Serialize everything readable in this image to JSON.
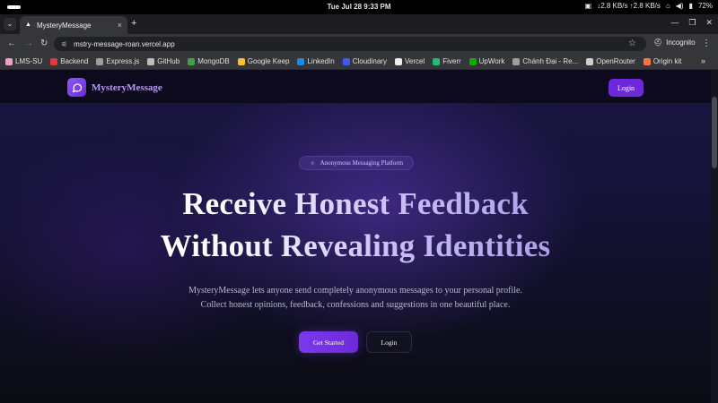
{
  "os": {
    "datetime": "Tue Jul 28   9:33 PM",
    "network_speed": "↓2.8 KB/s ↑2.8 KB/s",
    "battery": "72%"
  },
  "browser": {
    "tab_title": "MysteryMessage",
    "url": "mstry-message-roan.vercel.app",
    "incognito_label": "Incognito",
    "bookmarks": [
      {
        "label": "LMS-SU",
        "color": "#e9a3c9"
      },
      {
        "label": "Backend",
        "color": "#e53935"
      },
      {
        "label": "Express.js",
        "color": "#9e9e9e"
      },
      {
        "label": "GitHub",
        "color": "#bdbdbd"
      },
      {
        "label": "MongoDB",
        "color": "#43a047"
      },
      {
        "label": "Google Keep",
        "color": "#fbc02d"
      },
      {
        "label": "LinkedIn",
        "color": "#1e88e5"
      },
      {
        "label": "Cloudinary",
        "color": "#3d5afe"
      },
      {
        "label": "Vercel",
        "color": "#eeeeee"
      },
      {
        "label": "Fiverr",
        "color": "#1dbf73"
      },
      {
        "label": "UpWork",
        "color": "#14a800"
      },
      {
        "label": "Chánh Đại - Re...",
        "color": "#9e9e9e"
      },
      {
        "label": "OpenRouter",
        "color": "#cfcfcf"
      },
      {
        "label": "Origin kit",
        "color": "#ff7043"
      }
    ]
  },
  "site": {
    "brand": "MysteryMessage",
    "nav_login": "Login",
    "badge": "Anonymous Messaging Platform",
    "title_line1": "Receive Honest Feedback",
    "title_line2": "Without Revealing Identities",
    "subtitle_line1": "MysteryMessage lets anyone send completely anonymous messages to your personal profile.",
    "subtitle_line2": "Collect honest opinions, feedback, confessions and suggestions in one beautiful place.",
    "cta_primary": "Get Started",
    "cta_secondary": "Login",
    "accent_color": "#6d28d9"
  }
}
